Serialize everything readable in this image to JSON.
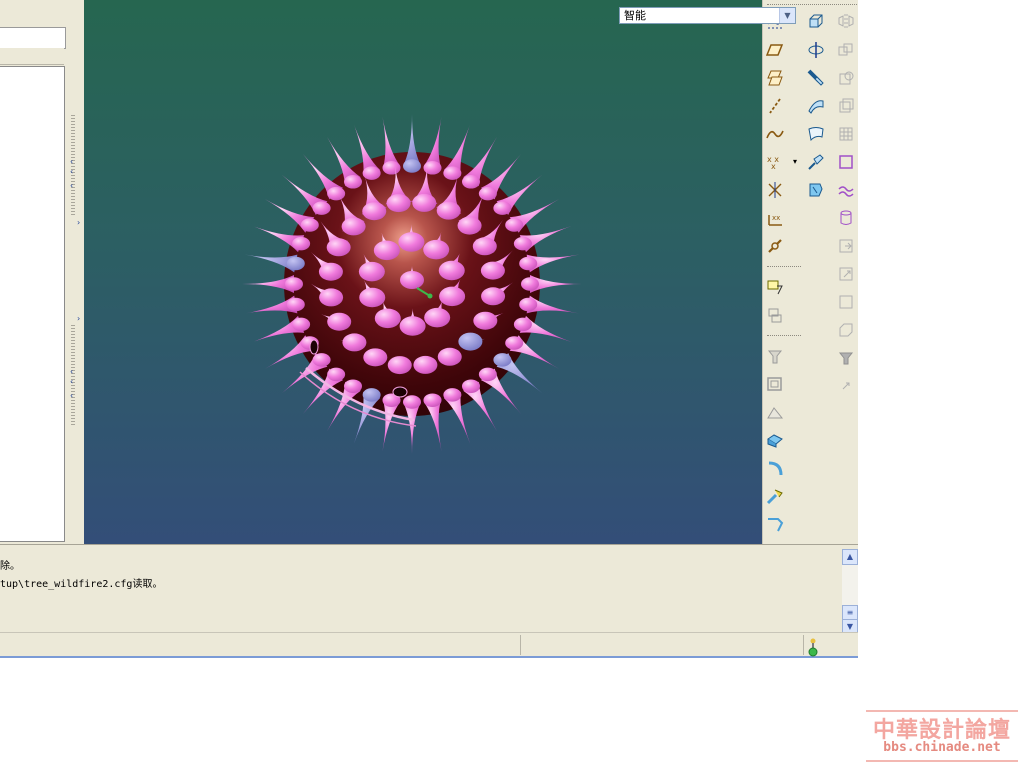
{
  "messages": {
    "line1": "除。",
    "line2": "tup\\tree_wildfire2.cfg读取。"
  },
  "status_bar": {
    "filter_value": "智能"
  },
  "viewport": {
    "model": "spiked-sphere",
    "colors": {
      "background_top": "#266650",
      "background_bottom": "#334e78",
      "sphere": "#5a0a0c",
      "spikes": "#f07adc",
      "highlighted_spikes": "#8a8ad0"
    }
  },
  "right_toolbar": {
    "icons": [
      "datum-curve-sketch-icon",
      "datum-plane-icon",
      "datum-plane-offset-icon",
      "datum-axis-icon",
      "datum-curve-icon",
      "datum-point-icon",
      "datum-point-offset-icon",
      "datum-csys-icon",
      "analysis-link-icon",
      "extrude-icon",
      "revolve-icon",
      "sweep-icon",
      "blend-icon",
      "boundary-blend-icon",
      "style-icon",
      "variable-section-sweep-icon",
      "swept-blend-icon",
      "mirror-icon",
      "merge-icon",
      "trim-icon",
      "offset-icon",
      "pattern-icon",
      "copy-icon",
      "project-icon",
      "cylinder-icon",
      "hole-icon",
      "round-icon",
      "shell-icon",
      "rib-icon",
      "draft-icon",
      "chamfer-icon",
      "edge-round-icon",
      "hammer-icon",
      "sheet-icon",
      "select-filter-icon",
      "annotation-icon",
      "block-icon",
      "small-arrow-icon"
    ]
  },
  "watermark": {
    "title": "中華設計論壇",
    "url": "bbs.chinade.net"
  }
}
